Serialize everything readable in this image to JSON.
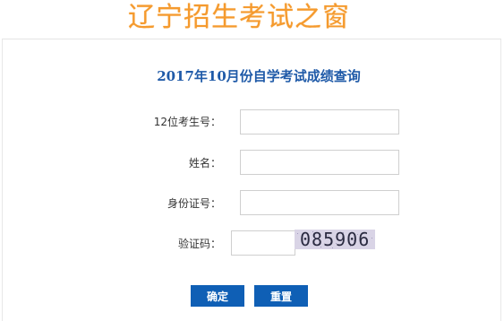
{
  "site": {
    "logo_text": "辽宁招生考试之窗"
  },
  "form": {
    "title": "2017年10月份自学考试成绩查询",
    "fields": {
      "exam_number": {
        "label": "12位考生号：",
        "value": ""
      },
      "name": {
        "label": "姓名：",
        "value": ""
      },
      "id_number": {
        "label": "身份证号：",
        "value": ""
      },
      "captcha": {
        "label": "验证码：",
        "value": ""
      }
    },
    "captcha_image_text": "085906",
    "buttons": {
      "submit": "确定",
      "reset": "重置"
    }
  },
  "colors": {
    "logo": "#f59a2e",
    "title": "#1f5aa8",
    "button": "#0f5fb5"
  }
}
